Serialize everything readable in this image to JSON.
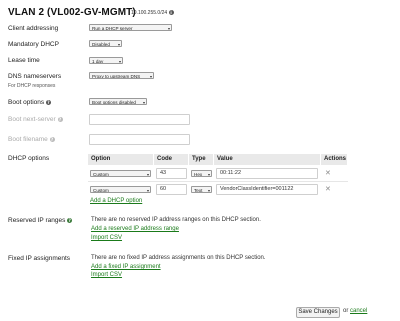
{
  "header": {
    "title": "VLAN 2 (VL002-GV-MGMT)",
    "subnet": "10.100.255.0/24",
    "info_icon": "i"
  },
  "fields": {
    "client_addressing": {
      "label": "Client addressing",
      "value": "Run a DHCP server"
    },
    "mandatory_dhcp": {
      "label": "Mandatory DHCP",
      "value": "Disabled"
    },
    "lease_time": {
      "label": "Lease time",
      "value": "1 day"
    },
    "dns_nameservers": {
      "label": "DNS nameservers",
      "sublabel": "For DHCP responses",
      "value": "Proxy to upstream DNS"
    },
    "boot_options": {
      "label": "Boot options",
      "value": "Boot options disabled"
    },
    "boot_next_server": {
      "label": "Boot next-server",
      "value": ""
    },
    "boot_filename": {
      "label": "Boot filename",
      "value": ""
    }
  },
  "dhcp_options": {
    "label": "DHCP options",
    "columns": {
      "option": "Option",
      "code": "Code",
      "type": "Type",
      "value": "Value",
      "actions": "Actions"
    },
    "rows": [
      {
        "option": "Custom",
        "code": "43",
        "type": "Hex",
        "value": "00:11:22"
      },
      {
        "option": "Custom",
        "code": "60",
        "type": "Text",
        "value": "VendorClassIdentifier=001122"
      }
    ],
    "add_link": "Add a DHCP option"
  },
  "reserved_ranges": {
    "label": "Reserved IP ranges",
    "message": "There are no reserved IP address ranges on this DHCP section.",
    "add_link": "Add a reserved IP address range",
    "import_link": "Import CSV"
  },
  "fixed_assignments": {
    "label": "Fixed IP assignments",
    "message": "There are no fixed IP address assignments on this DHCP section.",
    "add_link": "Add a fixed IP assignment",
    "import_link": "Import CSV"
  },
  "footer": {
    "save_label": "Save Changes",
    "or_text": "or",
    "cancel_label": "cancel"
  },
  "icons": {
    "caret": "▾",
    "delete": "✕",
    "help": "?"
  }
}
